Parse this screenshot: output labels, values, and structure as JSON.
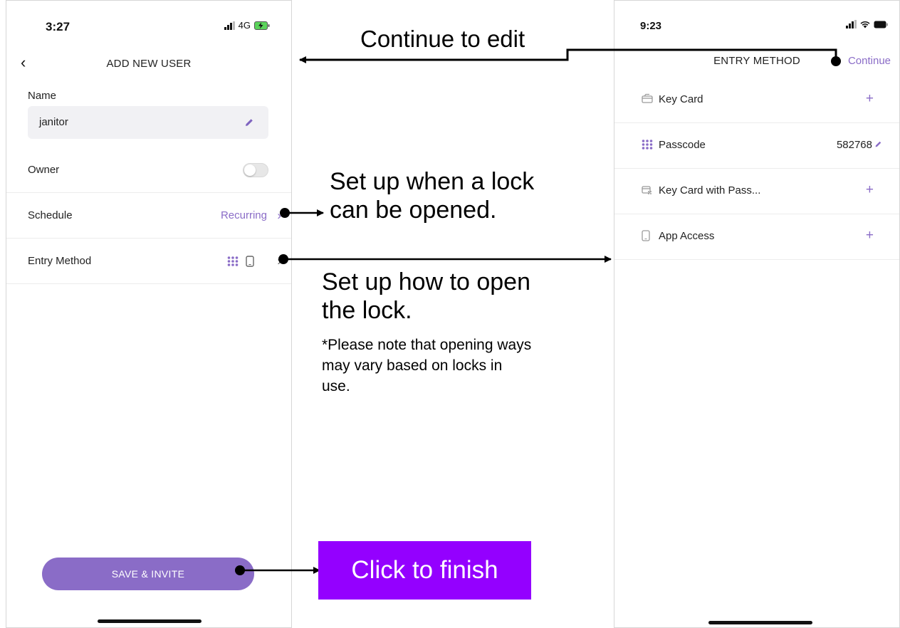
{
  "left_phone": {
    "status": {
      "time": "3:27",
      "network": "4G"
    },
    "title": "ADD NEW USER",
    "back_icon": "‹",
    "name_label": "Name",
    "name_value": "janitor",
    "owner_label": "Owner",
    "owner_on": false,
    "schedule_label": "Schedule",
    "schedule_value": "Recurring",
    "entry_method_label": "Entry Method",
    "save_label": "SAVE & INVITE",
    "accent": "#8a6cc7"
  },
  "right_phone": {
    "status": {
      "time": "9:23"
    },
    "title": "ENTRY METHOD",
    "continue_label": "Continue",
    "methods": [
      {
        "label": "Key Card",
        "icon": "key-card-icon",
        "action": "+"
      },
      {
        "label": "Passcode",
        "icon": "keypad-icon",
        "value": "582768"
      },
      {
        "label": "Key Card with Pass...",
        "icon": "key-card-pass-icon",
        "action": "+"
      },
      {
        "label": "App Access",
        "icon": "phone-icon",
        "action": "+"
      }
    ]
  },
  "annotations": {
    "continue_to_edit": "Continue to edit",
    "schedule_line1": "Set up when a lock",
    "schedule_line2": "can be opened.",
    "entry_line1": "Set up how to open",
    "entry_line2": "the lock.",
    "note_line1": "*Please note that opening ways",
    "note_line2": "may vary based on locks in",
    "note_line3": "use.",
    "finish": "Click to finish",
    "finish_color": "#9400ff"
  }
}
